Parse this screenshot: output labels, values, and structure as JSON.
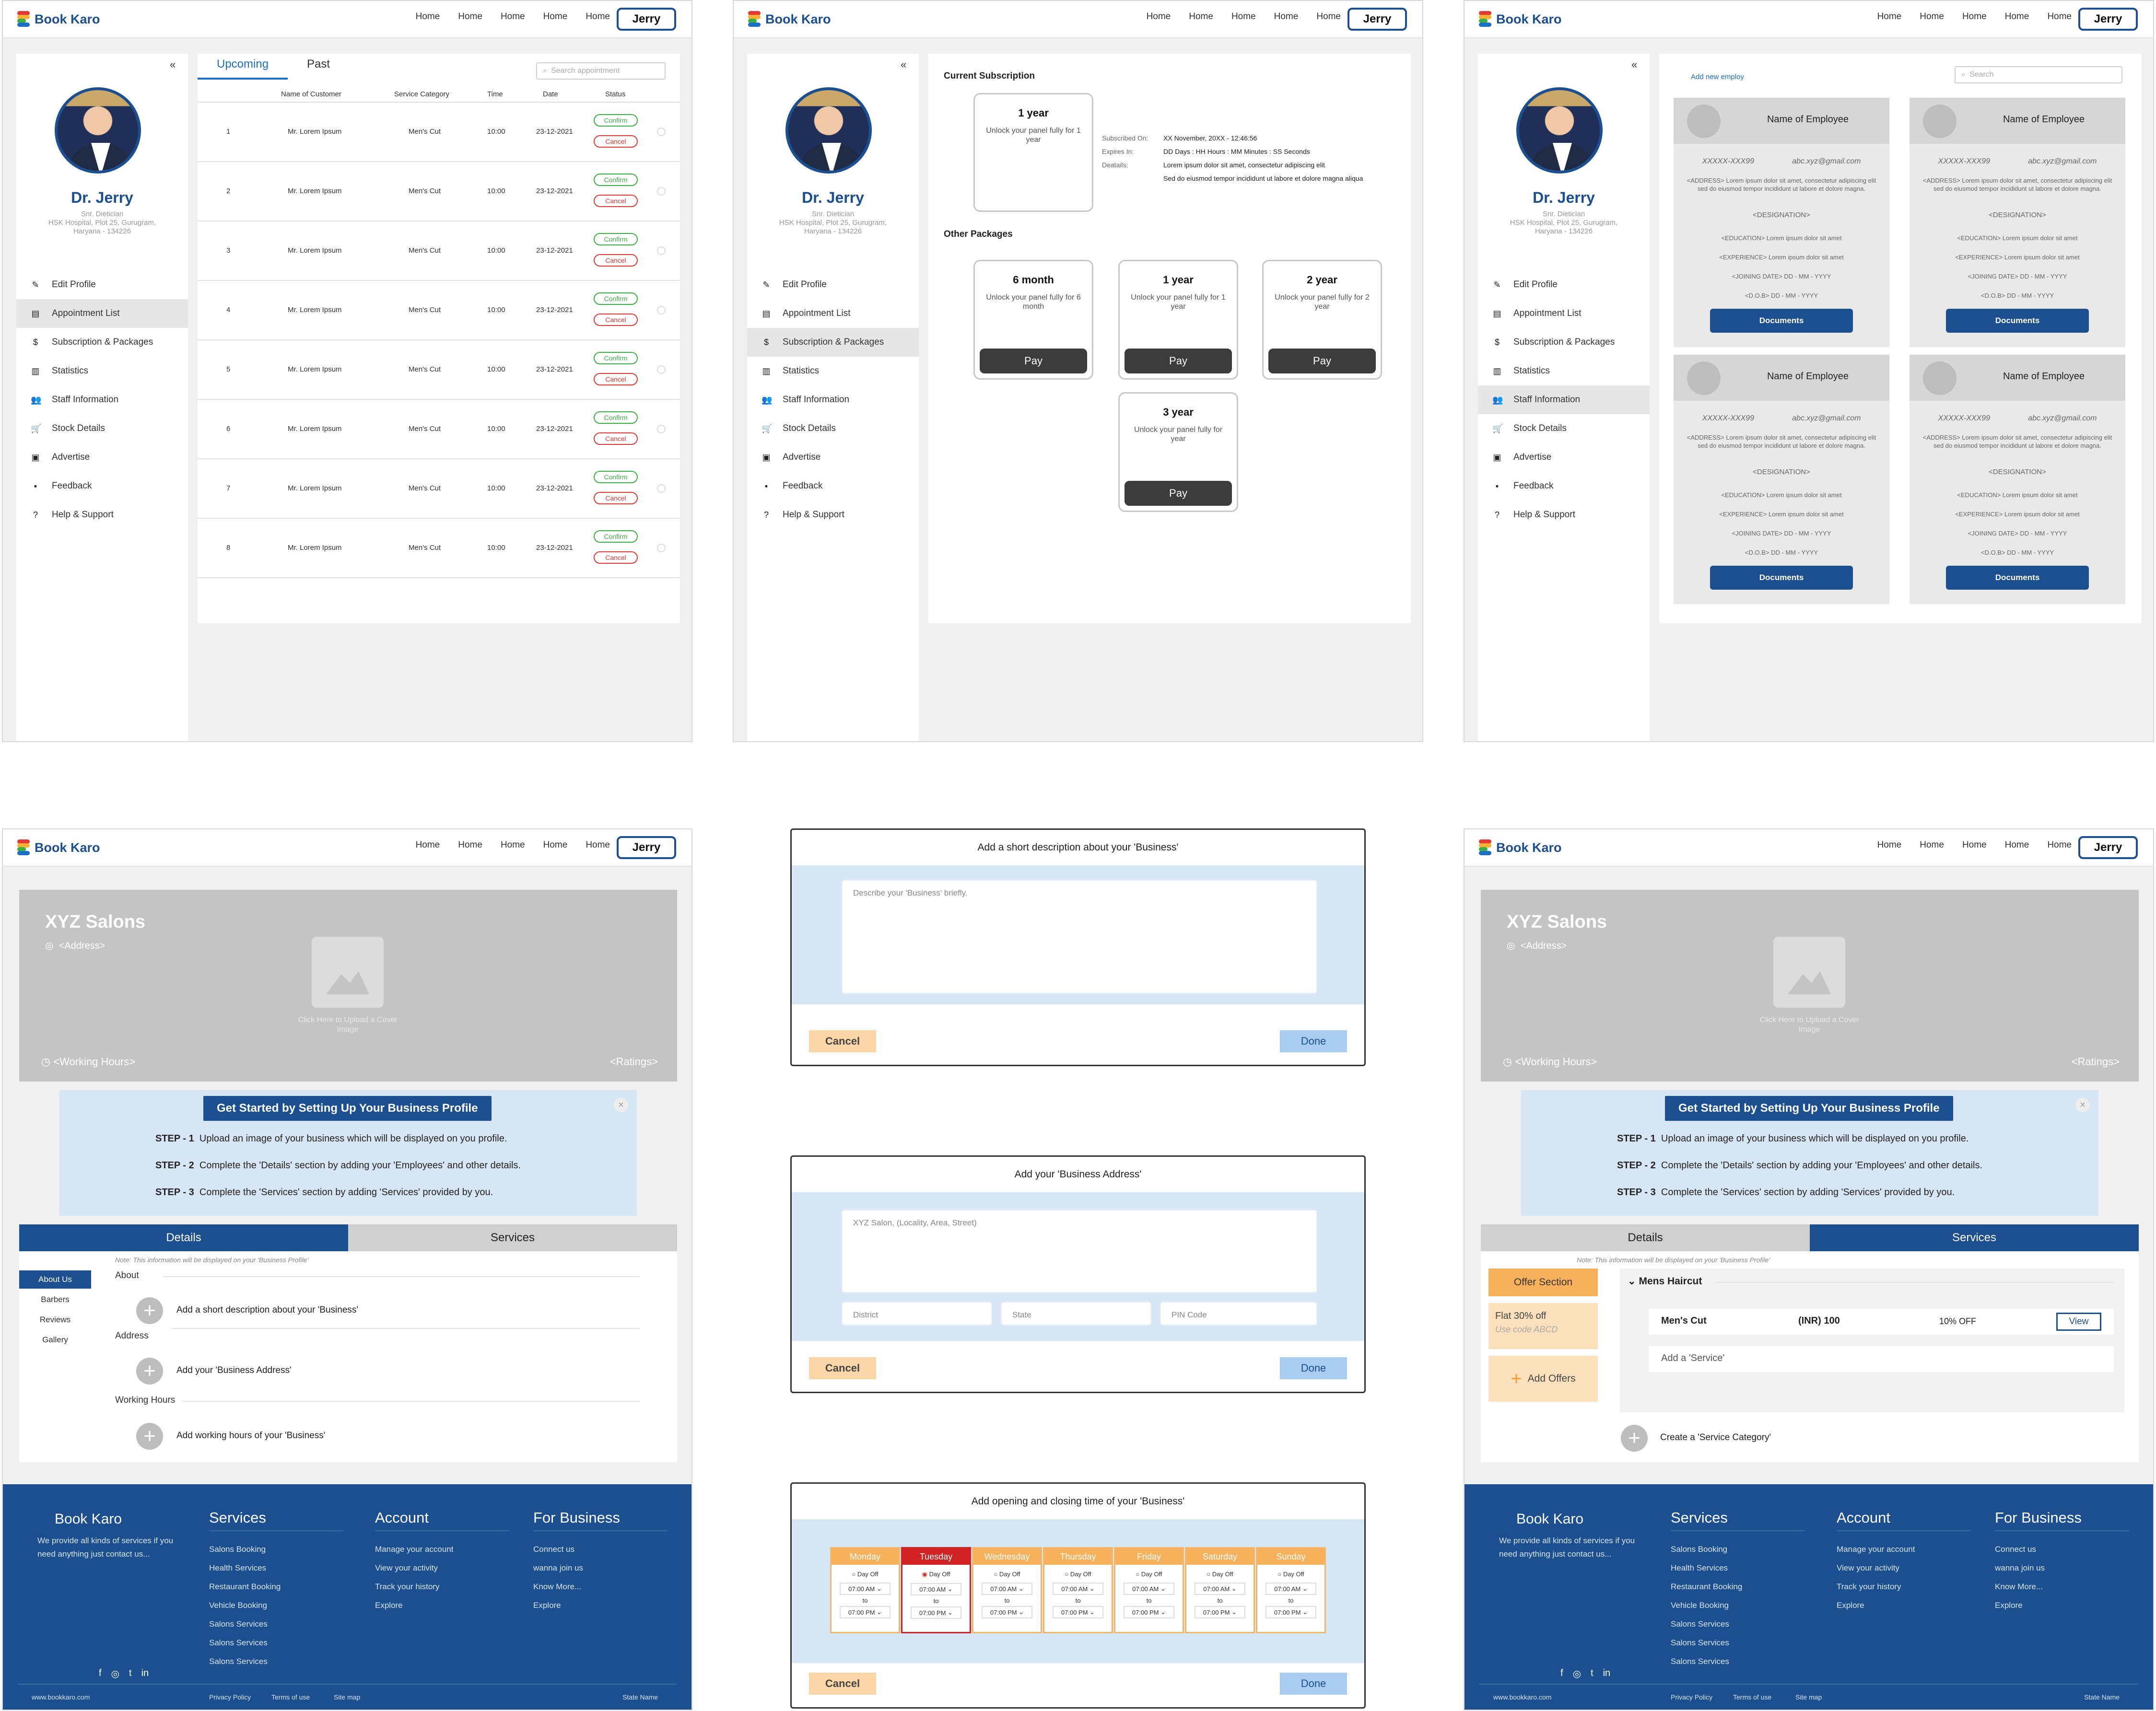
{
  "brand": {
    "name": "Book Karo",
    "colors": {
      "primary": "#1b4f8f",
      "accent": "#1b6fc4",
      "logo_red": "#e53935",
      "logo_yellow": "#f9b233",
      "logo_green": "#3cb043",
      "logo_blue": "#1b6fc4"
    }
  },
  "nav": {
    "links": [
      "Home",
      "Home",
      "Home",
      "Home",
      "Home"
    ],
    "user": "Jerry"
  },
  "profile": {
    "collapse": "«",
    "name": "Dr. Jerry",
    "role": "Snr. Dietician",
    "address": "HSK Hospital, Plot 25, Gurugram, Haryana - 134226"
  },
  "menu": [
    {
      "label": "Edit Profile",
      "icon": "pencil-icon"
    },
    {
      "label": "Appointment List",
      "icon": "list-icon"
    },
    {
      "label": "Subscription & Packages",
      "icon": "dollar-icon"
    },
    {
      "label": "Statistics",
      "icon": "chart-icon"
    },
    {
      "label": "Staff Information",
      "icon": "people-icon"
    },
    {
      "label": "Stock Details",
      "icon": "cart-icon"
    },
    {
      "label": "Advertise",
      "icon": "megaphone-icon"
    },
    {
      "label": "Feedback",
      "icon": "chat-icon"
    },
    {
      "label": "Help & Support",
      "icon": "help-icon"
    }
  ],
  "appointments": {
    "tabs": [
      "Upcoming",
      "Past"
    ],
    "search_placeholder": "Search appointment",
    "columns": [
      "Name of Customer",
      "Service Category",
      "Time",
      "Date",
      "Status"
    ],
    "confirm": "Confirm",
    "cancel": "Cancel",
    "rows": [
      {
        "n": "1",
        "name": "Mr. Lorem Ipsum",
        "cat": "Men's Cut",
        "time": "10:00",
        "date": "23-12-2021"
      },
      {
        "n": "2",
        "name": "Mr. Lorem Ipsum",
        "cat": "Men's Cut",
        "time": "10:00",
        "date": "23-12-2021"
      },
      {
        "n": "3",
        "name": "Mr. Lorem Ipsum",
        "cat": "Men's Cut",
        "time": "10:00",
        "date": "23-12-2021"
      },
      {
        "n": "4",
        "name": "Mr. Lorem Ipsum",
        "cat": "Men's Cut",
        "time": "10:00",
        "date": "23-12-2021"
      },
      {
        "n": "5",
        "name": "Mr. Lorem Ipsum",
        "cat": "Men's Cut",
        "time": "10:00",
        "date": "23-12-2021"
      },
      {
        "n": "6",
        "name": "Mr. Lorem Ipsum",
        "cat": "Men's Cut",
        "time": "10:00",
        "date": "23-12-2021"
      },
      {
        "n": "7",
        "name": "Mr. Lorem Ipsum",
        "cat": "Men's Cut",
        "time": "10:00",
        "date": "23-12-2021"
      },
      {
        "n": "8",
        "name": "Mr. Lorem Ipsum",
        "cat": "Men's Cut",
        "time": "10:00",
        "date": "23-12-2021"
      }
    ]
  },
  "subscription": {
    "current_title": "Current Subscription",
    "current": {
      "title": "1 year",
      "desc": "Unlock your panel fully for 1 year"
    },
    "details": [
      {
        "k": "Subscribed On:",
        "v": "XX November, 20XX - 12:46:56"
      },
      {
        "k": "Expires In:",
        "v": "DD Days : HH Hours : MM Minutes : SS Seconds"
      },
      {
        "k": "Deatails:",
        "v": "Lorem ipsum dolor sit amet, consectetur adipiscing elit"
      },
      {
        "k": "",
        "v": "Sed do eiusmod tempor incididunt ut labore et dolore magna aliqua"
      }
    ],
    "other_title": "Other Packages",
    "packages": [
      {
        "title": "6 month",
        "desc": "Unlock your panel fully for 6 month",
        "pay": "Pay"
      },
      {
        "title": "1 year",
        "desc": "Unlock your panel fully for 1 year",
        "pay": "Pay"
      },
      {
        "title": "2 year",
        "desc": "Unlock your panel fully for 2 year",
        "pay": "Pay"
      },
      {
        "title": "3 year",
        "desc": "Unlock your panel fully for  year",
        "pay": "Pay"
      }
    ]
  },
  "staff": {
    "add_label": "Add new employ",
    "search_placeholder": "Search",
    "card": {
      "name": "Name of Employee",
      "phone": "XXXXX-XXX99",
      "email": "abc.xyz@gmail.com",
      "address": "<ADDRESS> Lorem ipsum dolor sit amet, consectetur adipiscing elit sed do eiusmod tempor incididunt ut labore et dolore magna.",
      "designation": "<DESIGNATION>",
      "education": "<EDUCATION> Lorem ipsum dolor sit amet",
      "experience": "<EXPERIENCE> Lorem ipsum dolor sit amet",
      "joining": "<JOINING DATE> DD - MM - YYYY",
      "dob": "<D.O.B> DD - MM - YYYY",
      "documents": "Documents"
    }
  },
  "business": {
    "name": "XYZ Salons",
    "address": "<Address>",
    "upload": "Click Here to Upload a Cover Image",
    "hours": "<Working Hours>",
    "ratings": "<Ratings>",
    "guide_title": "Get Started by Setting Up Your Business Profile",
    "steps": [
      {
        "k": "STEP - 1",
        "v": "Upload an image of your business which will be displayed on you profile."
      },
      {
        "k": "STEP - 2",
        "v": "Complete the 'Details' section by adding your 'Employees' and other details."
      },
      {
        "k": "STEP - 3",
        "v": "Complete the 'Services' section by adding 'Services' provided by you."
      }
    ],
    "tabs": [
      "Details",
      "Services"
    ],
    "note": "Note: This information will be displayed on your 'Business Profile'",
    "side_tabs": [
      "About Us",
      "Barbers",
      "Reviews",
      "Gallery"
    ],
    "sections": [
      {
        "h": "About",
        "t": "Add a short description about your 'Business'"
      },
      {
        "h": "Address",
        "t": "Add your 'Business Address'"
      },
      {
        "h": "Working Hours",
        "t": "Add working hours of your 'Business'"
      }
    ],
    "services": {
      "offer_btn": "Offer Section",
      "offer": "Flat 30% off",
      "code": "Use code ABCD",
      "add_offers": "Add Offers",
      "category": "Mens Haircut",
      "service": "Men's Cut",
      "price": "(INR) 100",
      "discount": "10% OFF",
      "view": "View",
      "add_service": "Add a 'Service'",
      "create_category": "Create a 'Service Category'"
    }
  },
  "modals": {
    "desc": {
      "title": "Add a short description about your 'Business'",
      "placeholder": "Describe your 'Business' briefly."
    },
    "addr": {
      "title": "Add your 'Business Address'",
      "street": "XYZ Salon, (Locality, Area, Street)",
      "district": "District",
      "state": "State",
      "pin": "PIN Code"
    },
    "hours": {
      "title": "Add opening and closing time of your 'Business'",
      "days": [
        "Monday",
        "Tuesday",
        "Wednesday",
        "Thursday",
        "Friday",
        "Saturday",
        "Sunday"
      ],
      "day_off": "Day Off",
      "open": "07:00 AM",
      "close": "07:00 PM",
      "to": "to"
    },
    "cancel": "Cancel",
    "done": "Done"
  },
  "footer": {
    "desc": "We provide all kinds of services if you need anything just contact us...",
    "cols": [
      {
        "h": "Services",
        "items": [
          "Salons Booking",
          "Health Services",
          "Restaurant Booking",
          "Vehicle Booking",
          "Salons Services",
          "Salons Services",
          "Salons Services"
        ]
      },
      {
        "h": "Account",
        "items": [
          "Manage your account",
          "View your activity",
          "Track your history",
          "Explore"
        ]
      },
      {
        "h": "For Business",
        "items": [
          "Connect us",
          "wanna join us",
          "Know More...",
          "Explore"
        ]
      }
    ],
    "social": [
      "f",
      "◎",
      "t",
      "in"
    ],
    "url": "www.bookkaro.com",
    "links": [
      "Privacy Policy",
      "Terms of use",
      "Site map"
    ],
    "state": "State Name"
  }
}
